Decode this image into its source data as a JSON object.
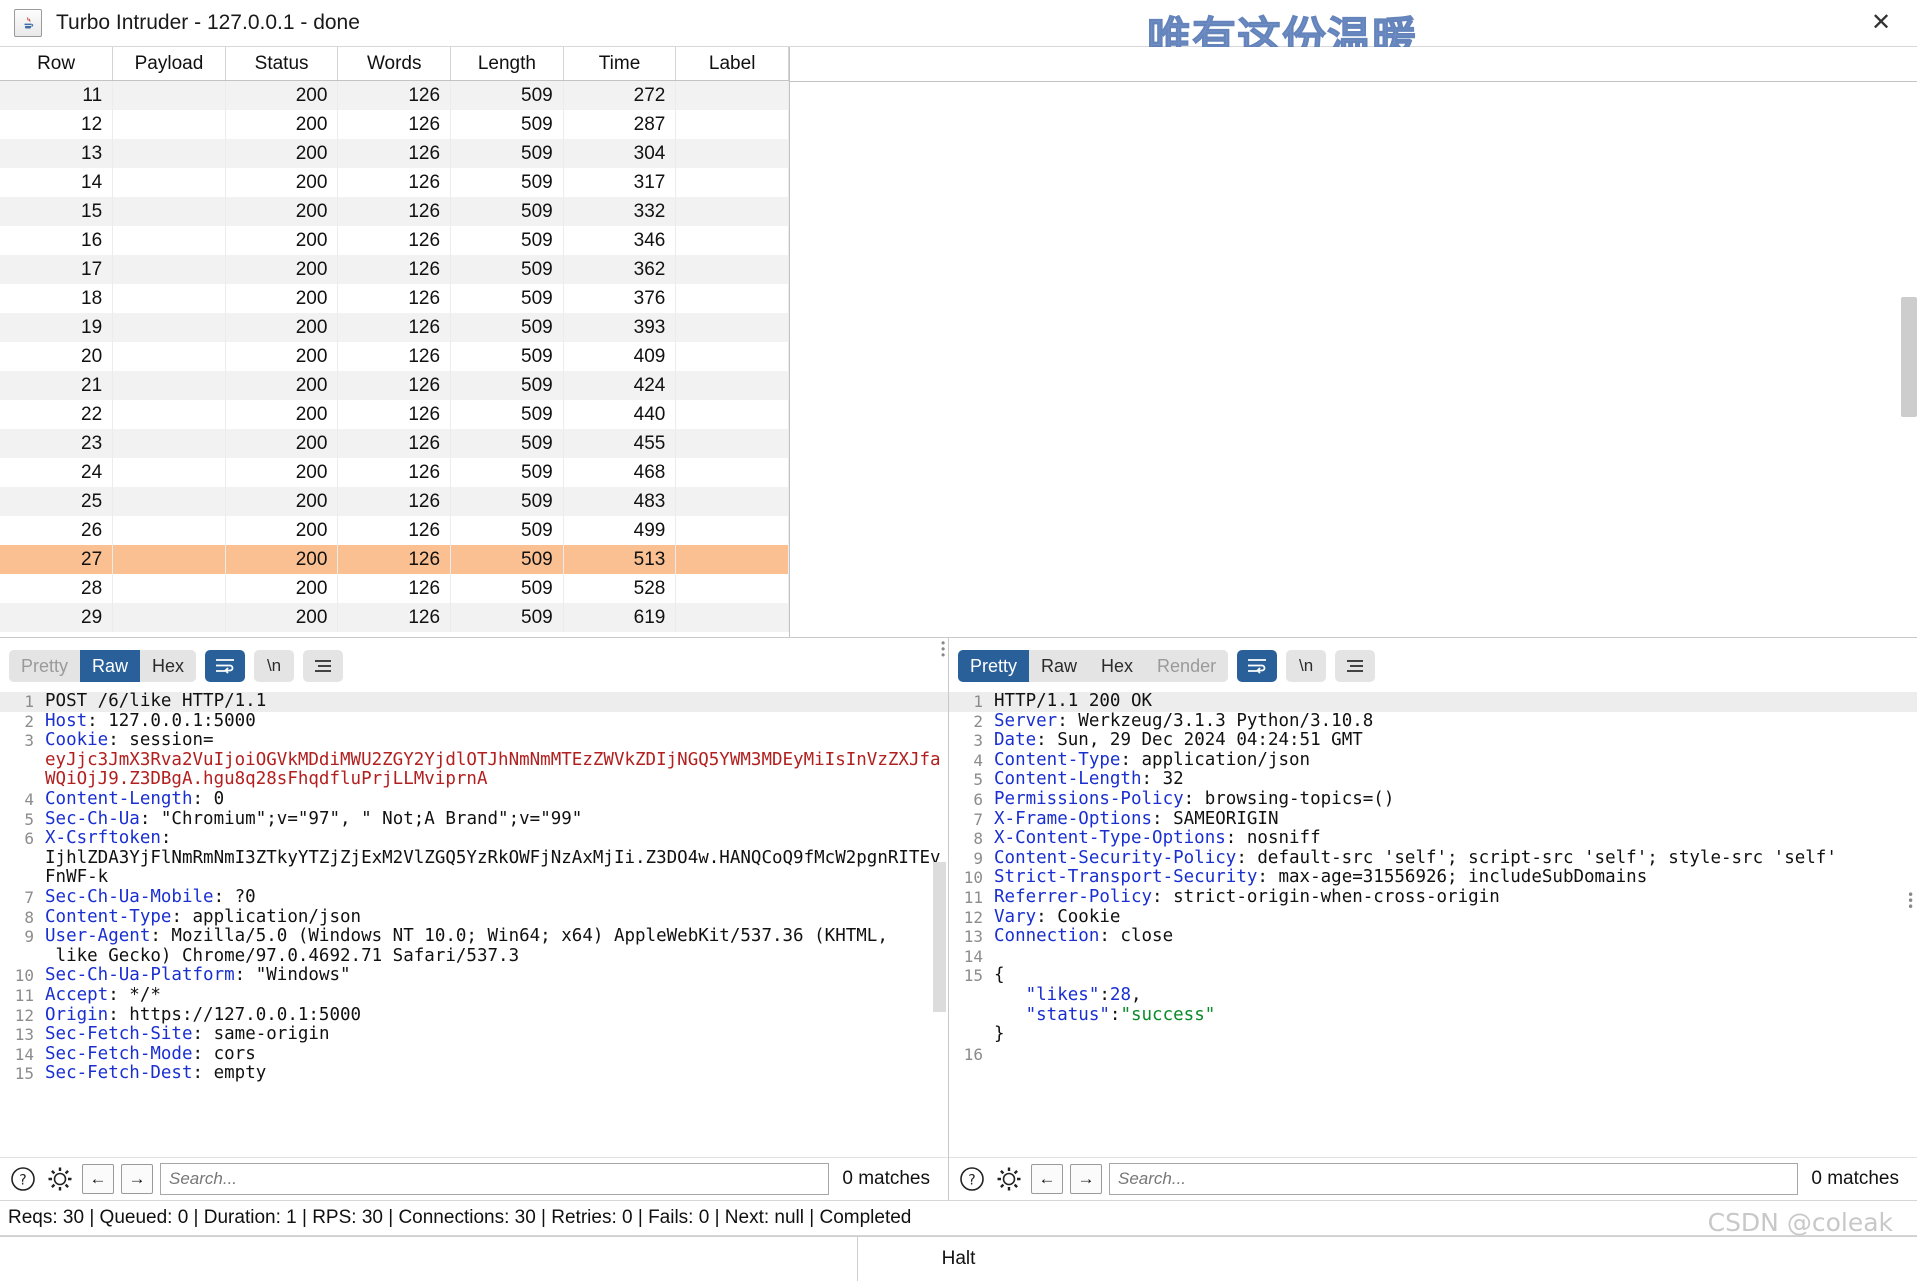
{
  "window": {
    "title": "Turbo Intruder - 127.0.0.1 - done",
    "app_icon": "java-coffee-icon",
    "close_icon": "close-icon",
    "watermark_cn": "唯有这份温暖",
    "watermark_csdn": "CSDN @coleak"
  },
  "table": {
    "columns": [
      "Row",
      "Payload",
      "Status",
      "Words",
      "Length",
      "Time",
      "Label"
    ],
    "rows": [
      {
        "row": "11",
        "payload": "",
        "status": "200",
        "words": "126",
        "length": "509",
        "time": "272",
        "label": ""
      },
      {
        "row": "12",
        "payload": "",
        "status": "200",
        "words": "126",
        "length": "509",
        "time": "287",
        "label": ""
      },
      {
        "row": "13",
        "payload": "",
        "status": "200",
        "words": "126",
        "length": "509",
        "time": "304",
        "label": ""
      },
      {
        "row": "14",
        "payload": "",
        "status": "200",
        "words": "126",
        "length": "509",
        "time": "317",
        "label": ""
      },
      {
        "row": "15",
        "payload": "",
        "status": "200",
        "words": "126",
        "length": "509",
        "time": "332",
        "label": ""
      },
      {
        "row": "16",
        "payload": "",
        "status": "200",
        "words": "126",
        "length": "509",
        "time": "346",
        "label": ""
      },
      {
        "row": "17",
        "payload": "",
        "status": "200",
        "words": "126",
        "length": "509",
        "time": "362",
        "label": ""
      },
      {
        "row": "18",
        "payload": "",
        "status": "200",
        "words": "126",
        "length": "509",
        "time": "376",
        "label": ""
      },
      {
        "row": "19",
        "payload": "",
        "status": "200",
        "words": "126",
        "length": "509",
        "time": "393",
        "label": ""
      },
      {
        "row": "20",
        "payload": "",
        "status": "200",
        "words": "126",
        "length": "509",
        "time": "409",
        "label": ""
      },
      {
        "row": "21",
        "payload": "",
        "status": "200",
        "words": "126",
        "length": "509",
        "time": "424",
        "label": ""
      },
      {
        "row": "22",
        "payload": "",
        "status": "200",
        "words": "126",
        "length": "509",
        "time": "440",
        "label": ""
      },
      {
        "row": "23",
        "payload": "",
        "status": "200",
        "words": "126",
        "length": "509",
        "time": "455",
        "label": ""
      },
      {
        "row": "24",
        "payload": "",
        "status": "200",
        "words": "126",
        "length": "509",
        "time": "468",
        "label": ""
      },
      {
        "row": "25",
        "payload": "",
        "status": "200",
        "words": "126",
        "length": "509",
        "time": "483",
        "label": ""
      },
      {
        "row": "26",
        "payload": "",
        "status": "200",
        "words": "126",
        "length": "509",
        "time": "499",
        "label": ""
      },
      {
        "row": "27",
        "payload": "",
        "status": "200",
        "words": "126",
        "length": "509",
        "time": "513",
        "label": "",
        "selected": true
      },
      {
        "row": "28",
        "payload": "",
        "status": "200",
        "words": "126",
        "length": "509",
        "time": "528",
        "label": ""
      },
      {
        "row": "29",
        "payload": "",
        "status": "200",
        "words": "126",
        "length": "509",
        "time": "619",
        "label": ""
      }
    ],
    "selected_row": "27",
    "selected_color": "#fac091"
  },
  "request": {
    "toolbar": {
      "views": [
        {
          "label": "Pretty",
          "state": "disabled"
        },
        {
          "label": "Raw",
          "state": "active"
        },
        {
          "label": "Hex",
          "state": "normal"
        }
      ],
      "wrap_icon": "word-wrap-icon",
      "newline_label": "\\n",
      "menu_icon": "hamburger-menu-icon"
    },
    "lines": [
      {
        "n": "1",
        "highlight": true,
        "segments": [
          {
            "t": "POST /6/like HTTP/1.1",
            "c": "plain"
          }
        ]
      },
      {
        "n": "2",
        "segments": [
          {
            "t": "Host",
            "c": "hdr"
          },
          {
            "t": ": 127.0.0.1:5000",
            "c": "plain"
          }
        ]
      },
      {
        "n": "3",
        "segments": [
          {
            "t": "Cookie",
            "c": "hdr"
          },
          {
            "t": ": session=",
            "c": "plain"
          }
        ]
      },
      {
        "n": "",
        "wrap": true,
        "segments": [
          {
            "t": "eyJjc3JmX3Rva2VuIjoiOGVkMDdiMWU2ZGY2YjdlOTJhNmNmMTEzZWVkZDIjNGQ5YWM3MDEyMiIsInVzZXJfaWQiOjJ9.Z3DBgA.hgu8q28sFhqdfluPrjLLMviprnA",
            "c": "red"
          }
        ]
      },
      {
        "n": "4",
        "segments": [
          {
            "t": "Content-Length",
            "c": "hdr"
          },
          {
            "t": ": 0",
            "c": "plain"
          }
        ]
      },
      {
        "n": "5",
        "segments": [
          {
            "t": "Sec-Ch-Ua",
            "c": "hdr"
          },
          {
            "t": ": \"Chromium\";v=\"97\", \" Not;A Brand\";v=\"99\"",
            "c": "plain"
          }
        ]
      },
      {
        "n": "6",
        "segments": [
          {
            "t": "X-Csrftoken",
            "c": "hdr"
          },
          {
            "t": ":",
            "c": "plain"
          }
        ]
      },
      {
        "n": "",
        "wrap": true,
        "segments": [
          {
            "t": "IjhlZDA3YjFlNmRmNmI3ZTkyYTZjZjExM2VlZGQ5YzRkOWFjNzAxMjIi.Z3DO4w.HANQCoQ9fMcW2pgnRITEvFnWF-k",
            "c": "plain"
          }
        ]
      },
      {
        "n": "7",
        "segments": [
          {
            "t": "Sec-Ch-Ua-Mobile",
            "c": "hdr"
          },
          {
            "t": ": ?0",
            "c": "plain"
          }
        ]
      },
      {
        "n": "8",
        "segments": [
          {
            "t": "Content-Type",
            "c": "hdr"
          },
          {
            "t": ": application/json",
            "c": "plain"
          }
        ]
      },
      {
        "n": "9",
        "segments": [
          {
            "t": "User-Agent",
            "c": "hdr"
          },
          {
            "t": ": Mozilla/5.0 (Windows NT 10.0; Win64; x64) AppleWebKit/537.36 (KHTML,",
            "c": "plain"
          }
        ]
      },
      {
        "n": "",
        "segments": [
          {
            "t": " like Gecko) Chrome/97.0.4692.71 Safari/537.3",
            "c": "plain"
          }
        ]
      },
      {
        "n": "10",
        "segments": [
          {
            "t": "Sec-Ch-Ua-Platform",
            "c": "hdr"
          },
          {
            "t": ": \"Windows\"",
            "c": "plain"
          }
        ]
      },
      {
        "n": "11",
        "segments": [
          {
            "t": "Accept",
            "c": "hdr"
          },
          {
            "t": ": */*",
            "c": "plain"
          }
        ]
      },
      {
        "n": "12",
        "segments": [
          {
            "t": "Origin",
            "c": "hdr"
          },
          {
            "t": ": https://127.0.0.1:5000",
            "c": "plain"
          }
        ]
      },
      {
        "n": "13",
        "segments": [
          {
            "t": "Sec-Fetch-Site",
            "c": "hdr"
          },
          {
            "t": ": same-origin",
            "c": "plain"
          }
        ]
      },
      {
        "n": "14",
        "segments": [
          {
            "t": "Sec-Fetch-Mode",
            "c": "hdr"
          },
          {
            "t": ": cors",
            "c": "plain"
          }
        ]
      },
      {
        "n": "15",
        "segments": [
          {
            "t": "Sec-Fetch-Dest",
            "c": "hdr"
          },
          {
            "t": ": empty",
            "c": "plain"
          }
        ]
      }
    ],
    "search": {
      "placeholder": "Search...",
      "value": "",
      "matches": "0 matches",
      "help_icon": "question-mark-icon",
      "settings_icon": "gear-icon",
      "prev_icon": "arrow-left-icon",
      "next_icon": "arrow-right-icon"
    }
  },
  "response": {
    "toolbar": {
      "views": [
        {
          "label": "Pretty",
          "state": "active"
        },
        {
          "label": "Raw",
          "state": "normal"
        },
        {
          "label": "Hex",
          "state": "normal"
        },
        {
          "label": "Render",
          "state": "disabled"
        }
      ],
      "wrap_icon": "word-wrap-icon",
      "newline_label": "\\n",
      "menu_icon": "hamburger-menu-icon"
    },
    "lines": [
      {
        "n": "1",
        "highlight": true,
        "segments": [
          {
            "t": "HTTP/1.1 200 OK",
            "c": "plain"
          }
        ]
      },
      {
        "n": "2",
        "segments": [
          {
            "t": "Server",
            "c": "hdr"
          },
          {
            "t": ": Werkzeug/3.1.3 Python/3.10.8",
            "c": "plain"
          }
        ]
      },
      {
        "n": "3",
        "segments": [
          {
            "t": "Date",
            "c": "hdr"
          },
          {
            "t": ": Sun, 29 Dec 2024 04:24:51 GMT",
            "c": "plain"
          }
        ]
      },
      {
        "n": "4",
        "segments": [
          {
            "t": "Content-Type",
            "c": "hdr"
          },
          {
            "t": ": application/json",
            "c": "plain"
          }
        ]
      },
      {
        "n": "5",
        "segments": [
          {
            "t": "Content-Length",
            "c": "hdr"
          },
          {
            "t": ": 32",
            "c": "plain"
          }
        ]
      },
      {
        "n": "6",
        "segments": [
          {
            "t": "Permissions-Policy",
            "c": "hdr"
          },
          {
            "t": ": browsing-topics=()",
            "c": "plain"
          }
        ]
      },
      {
        "n": "7",
        "segments": [
          {
            "t": "X-Frame-Options",
            "c": "hdr"
          },
          {
            "t": ": SAMEORIGIN",
            "c": "plain"
          }
        ]
      },
      {
        "n": "8",
        "segments": [
          {
            "t": "X-Content-Type-Options",
            "c": "hdr"
          },
          {
            "t": ": nosniff",
            "c": "plain"
          }
        ]
      },
      {
        "n": "9",
        "segments": [
          {
            "t": "Content-Security-Policy",
            "c": "hdr"
          },
          {
            "t": ": default-src 'self'; script-src 'self'; style-src 'self'",
            "c": "plain"
          }
        ]
      },
      {
        "n": "10",
        "segments": [
          {
            "t": "Strict-Transport-Security",
            "c": "hdr"
          },
          {
            "t": ": max-age=31556926; includeSubDomains",
            "c": "plain"
          }
        ]
      },
      {
        "n": "11",
        "segments": [
          {
            "t": "Referrer-Policy",
            "c": "hdr"
          },
          {
            "t": ": strict-origin-when-cross-origin",
            "c": "plain"
          }
        ]
      },
      {
        "n": "12",
        "segments": [
          {
            "t": "Vary",
            "c": "hdr"
          },
          {
            "t": ": Cookie",
            "c": "plain"
          }
        ]
      },
      {
        "n": "13",
        "segments": [
          {
            "t": "Connection",
            "c": "hdr"
          },
          {
            "t": ": close",
            "c": "plain"
          }
        ]
      },
      {
        "n": "14",
        "segments": [
          {
            "t": "",
            "c": "plain"
          }
        ]
      },
      {
        "n": "15",
        "segments": [
          {
            "t": "{",
            "c": "plain"
          }
        ]
      },
      {
        "n": "",
        "segments": [
          {
            "t": "   \"likes\"",
            "c": "blue"
          },
          {
            "t": ":",
            "c": "plain"
          },
          {
            "t": "28",
            "c": "blue"
          },
          {
            "t": ",",
            "c": "plain"
          }
        ]
      },
      {
        "n": "",
        "segments": [
          {
            "t": "   \"status\"",
            "c": "blue"
          },
          {
            "t": ":",
            "c": "plain"
          },
          {
            "t": "\"success\"",
            "c": "green"
          }
        ]
      },
      {
        "n": "",
        "segments": [
          {
            "t": "}",
            "c": "plain"
          }
        ]
      },
      {
        "n": "16",
        "segments": [
          {
            "t": "",
            "c": "plain"
          }
        ]
      }
    ],
    "search": {
      "placeholder": "Search...",
      "value": "",
      "matches": "0 matches",
      "help_icon": "question-mark-icon",
      "settings_icon": "gear-icon",
      "prev_icon": "arrow-left-icon",
      "next_icon": "arrow-right-icon"
    }
  },
  "status": {
    "text": "Reqs: 30 | Queued: 0 | Duration: 1 | RPS: 30 | Connections: 30 | Retries: 0 | Fails: 0 | Next: null | Completed"
  },
  "halt": {
    "label": "Halt"
  }
}
